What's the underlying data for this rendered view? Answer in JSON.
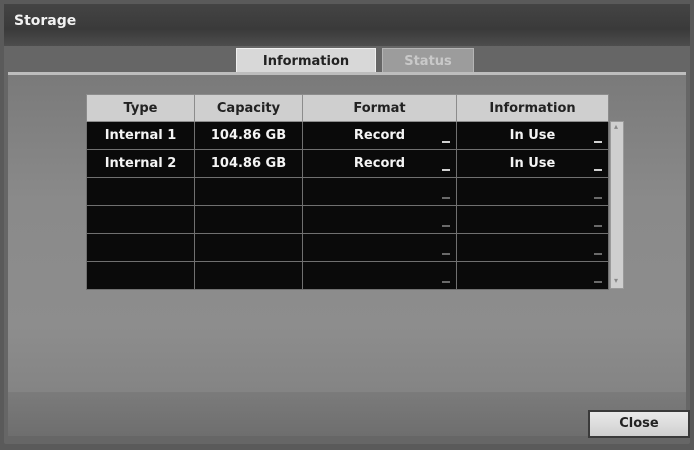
{
  "window": {
    "title": "Storage"
  },
  "tabs": [
    {
      "label": "Information",
      "active": true
    },
    {
      "label": "Status",
      "active": false
    }
  ],
  "table": {
    "columns": [
      "Type",
      "Capacity",
      "Format",
      "Information"
    ],
    "rows": [
      {
        "type": "Internal 1",
        "capacity": "104.86 GB",
        "format": "Record",
        "information": "In Use"
      },
      {
        "type": "Internal 2",
        "capacity": "104.86 GB",
        "format": "Record",
        "information": "In Use"
      },
      {
        "type": "",
        "capacity": "",
        "format": "",
        "information": ""
      },
      {
        "type": "",
        "capacity": "",
        "format": "",
        "information": ""
      },
      {
        "type": "",
        "capacity": "",
        "format": "",
        "information": ""
      },
      {
        "type": "",
        "capacity": "",
        "format": "",
        "information": ""
      }
    ]
  },
  "footer": {
    "close_label": "Close"
  },
  "colors": {
    "table_body": "#0a0a0a",
    "header_bg": "#cfcfcf",
    "tab_active": "#d8d8d8",
    "tab_inactive": "#9c9c9c"
  }
}
